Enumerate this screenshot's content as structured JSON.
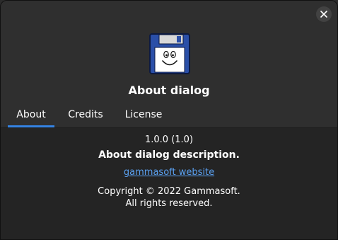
{
  "window": {
    "close_icon": "close-icon"
  },
  "header": {
    "logo_icon": "floppy-disk-face-icon",
    "app_name": "About dialog"
  },
  "tabs": [
    {
      "label": "About",
      "selected": true
    },
    {
      "label": "Credits",
      "selected": false
    },
    {
      "label": "License",
      "selected": false
    }
  ],
  "about": {
    "version": "1.0.0 (1.0)",
    "description": "About dialog description.",
    "website_label": "gammasoft website",
    "copyright_line1": "Copyright © 2022 Gammasoft.",
    "copyright_line2": "All rights reserved."
  },
  "colors": {
    "accent": "#3584e4",
    "link": "#5aa0f0",
    "background": "#242424",
    "header_bg": "#2f2f2f"
  }
}
